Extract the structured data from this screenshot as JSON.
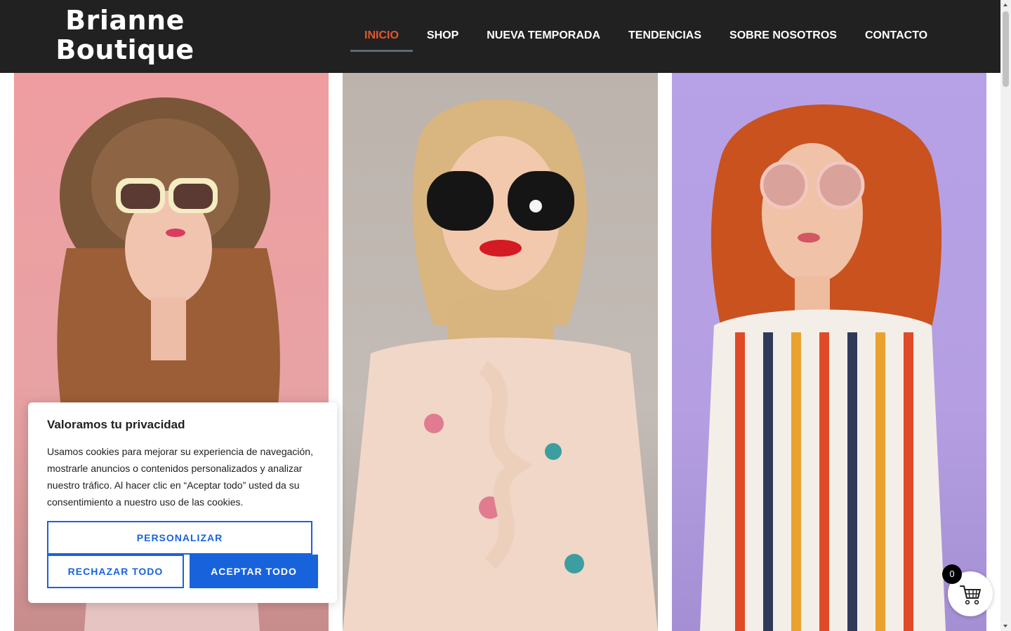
{
  "header": {
    "logo_line1": "Brianne",
    "logo_line2": "Boutique"
  },
  "nav": {
    "items": [
      {
        "label": "INICIO",
        "active": true
      },
      {
        "label": "SHOP"
      },
      {
        "label": "NUEVA TEMPORADA"
      },
      {
        "label": "TENDENCIAS"
      },
      {
        "label": "SOBRE NOSOTROS"
      },
      {
        "label": "CONTACTO"
      }
    ]
  },
  "gallery": {
    "photos": [
      {
        "icon": "woman-straw-hat-sunglasses-photo"
      },
      {
        "icon": "woman-blonde-sunglasses-photo"
      },
      {
        "icon": "woman-red-curly-hair-sunglasses-photo"
      }
    ]
  },
  "cookie": {
    "title": "Valoramos tu privacidad",
    "text": "Usamos cookies para mejorar su experiencia de navegación, mostrarle anuncios o contenidos personalizados y analizar nuestro tráfico. Al hacer clic en “Aceptar todo” usted da su consentimiento a nuestro uso de las cookies.",
    "customize_label": "PERSONALIZAR",
    "reject_label": "RECHAZAR TODO",
    "accept_label": "ACEPTAR TODO"
  },
  "cart": {
    "count": "0",
    "icon": "cart-icon"
  },
  "colors": {
    "header_bg": "#212121",
    "nav_active": "#e2572c",
    "cookie_accent": "#1863dc"
  }
}
